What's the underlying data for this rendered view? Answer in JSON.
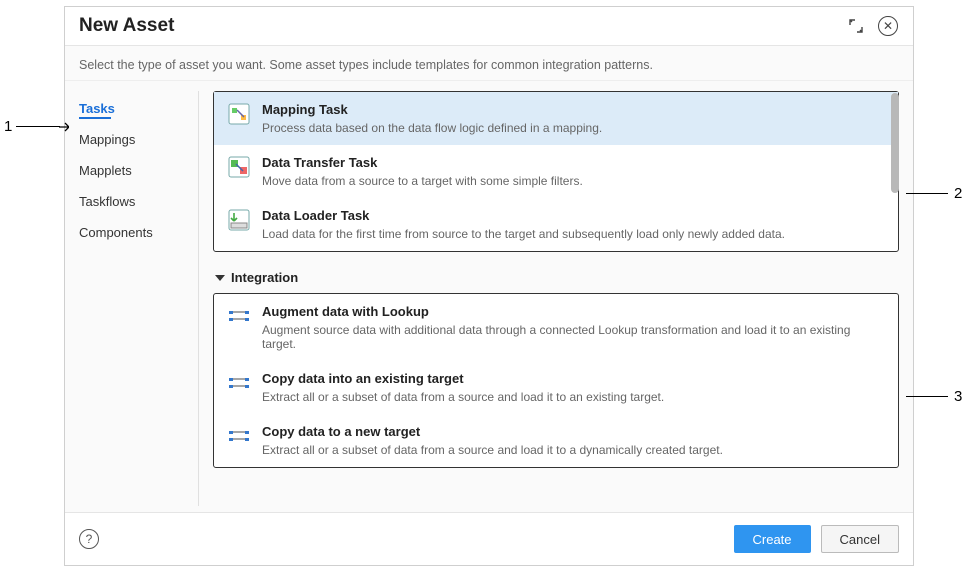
{
  "dialog": {
    "title": "New Asset",
    "subtitle": "Select the type of asset you want. Some asset types include templates for common integration patterns."
  },
  "sidebar": {
    "items": [
      {
        "label": "Tasks",
        "active": true
      },
      {
        "label": "Mappings",
        "active": false
      },
      {
        "label": "Mapplets",
        "active": false
      },
      {
        "label": "Taskflows",
        "active": false
      },
      {
        "label": "Components",
        "active": false
      }
    ]
  },
  "primary_group": [
    {
      "title": "Mapping Task",
      "desc": "Process data based on the data flow logic defined in a mapping.",
      "icon": "mapping-task-icon",
      "selected": true
    },
    {
      "title": "Data Transfer Task",
      "desc": "Move data from a source to a target with some simple filters.",
      "icon": "data-transfer-icon",
      "selected": false
    },
    {
      "title": "Data Loader Task",
      "desc": "Load data for the first time from source to the target and subsequently load only newly added data.",
      "icon": "data-loader-icon",
      "selected": false
    }
  ],
  "section": {
    "label": "Integration"
  },
  "templates_group": [
    {
      "title": "Augment data with Lookup",
      "desc": "Augment source data with additional data through a connected Lookup transformation and load it to an existing target.",
      "icon": "template-icon"
    },
    {
      "title": "Copy data into an existing target",
      "desc": "Extract all or a subset of data from a source and load it to an existing target.",
      "icon": "template-icon"
    },
    {
      "title": "Copy data to a new target",
      "desc": "Extract all or a subset of data from a source and load it to a dynamically created target.",
      "icon": "template-icon"
    }
  ],
  "footer": {
    "create": "Create",
    "cancel": "Cancel"
  },
  "callouts": {
    "c1": "1",
    "c2": "2",
    "c3": "3"
  }
}
